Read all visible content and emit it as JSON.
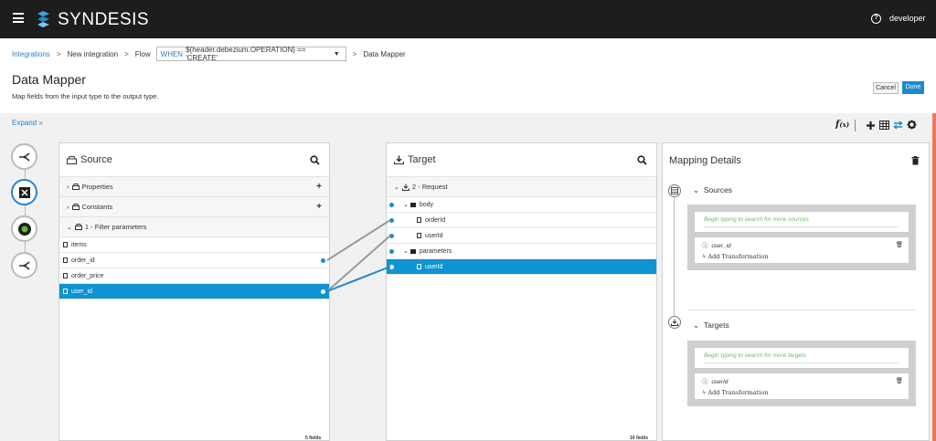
{
  "app": {
    "brand": "SYNDESIS",
    "user": "developer"
  },
  "breadcrumb": {
    "integrations": "Integrations",
    "new_integration": "New integration",
    "flow": "Flow",
    "flow_when": "WHEN",
    "flow_condition": "${header.debezium.OPERATION} == 'CREATE'",
    "current": "Data Mapper"
  },
  "page": {
    "title": "Data Mapper",
    "subtitle": "Map fields from the input type to the output type."
  },
  "actions": {
    "cancel": "Cancel",
    "done": "Done"
  },
  "rail": {
    "expand": "Expand"
  },
  "source": {
    "title": "Source",
    "sections": [
      "Properties",
      "Constants",
      "1 - Filter parameters"
    ],
    "fields": [
      "items",
      "order_id",
      "order_price",
      "user_id"
    ],
    "count": "5 fields"
  },
  "target": {
    "title": "Target",
    "root": "2 - Request",
    "body": "body",
    "body_fields": [
      "orderId",
      "userId"
    ],
    "parameters": "parameters",
    "parameter_fields": [
      "userId"
    ],
    "count": "10 fields"
  },
  "details": {
    "title": "Mapping Details",
    "sources_label": "Sources",
    "sources_placeholder": "Begin typing to search for more sources",
    "source_field": "user_id",
    "add_transformation": "Add Transformation",
    "targets_label": "Targets",
    "targets_placeholder": "Begin typing to search for more targets",
    "target_field": "userId"
  },
  "colors": {
    "accent": "#0f93d2",
    "topbar": "#1d1d1d",
    "mapping_line": "#999999"
  }
}
